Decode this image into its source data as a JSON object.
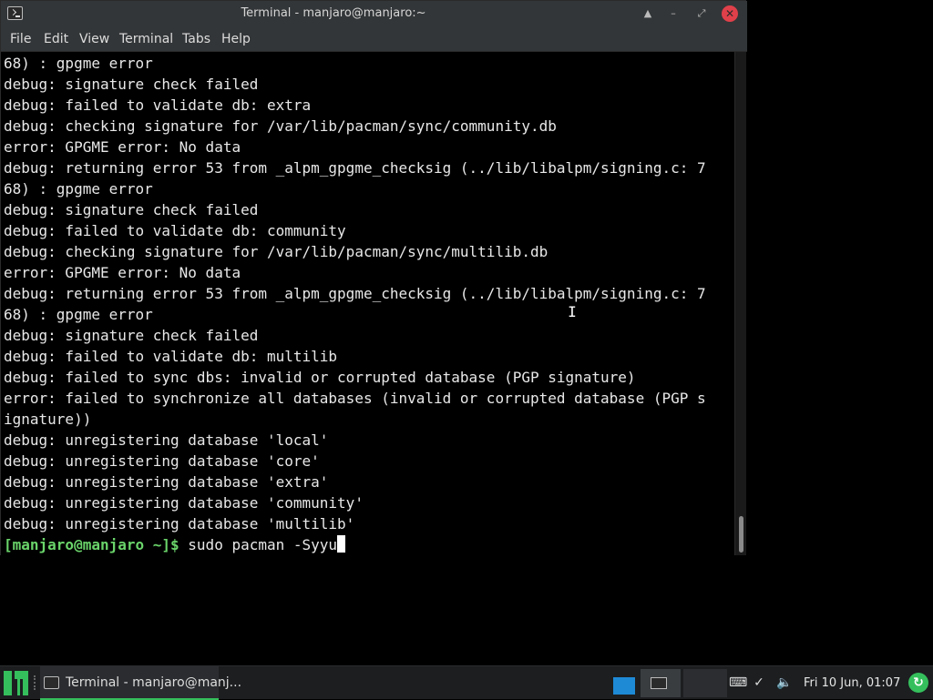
{
  "window": {
    "title": "Terminal - manjaro@manjaro:~"
  },
  "menu": {
    "items": [
      "File",
      "Edit",
      "View",
      "Terminal",
      "Tabs",
      "Help"
    ]
  },
  "terminal": {
    "lines": [
      "68) : gpgme error",
      "debug: signature check failed",
      "debug: failed to validate db: extra",
      "debug: checking signature for /var/lib/pacman/sync/community.db",
      "error: GPGME error: No data",
      "debug: returning error 53 from _alpm_gpgme_checksig (../lib/libalpm/signing.c: 7",
      "68) : gpgme error",
      "debug: signature check failed",
      "debug: failed to validate db: community",
      "debug: checking signature for /var/lib/pacman/sync/multilib.db",
      "error: GPGME error: No data",
      "debug: returning error 53 from _alpm_gpgme_checksig (../lib/libalpm/signing.c: 7",
      "68) : gpgme error",
      "debug: signature check failed",
      "debug: failed to validate db: multilib",
      "debug: failed to sync dbs: invalid or corrupted database (PGP signature)",
      "error: failed to synchronize all databases (invalid or corrupted database (PGP s",
      "ignature))",
      "debug: unregistering database 'local'",
      "debug: unregistering database 'core'",
      "debug: unregistering database 'extra'",
      "debug: unregistering database 'community'",
      "debug: unregistering database 'multilib'"
    ],
    "prompt": "[manjaro@manjaro ~]$",
    "command": " sudo pacman -Syyu"
  },
  "taskbar": {
    "task_label": "Terminal - manjaro@manj...",
    "clock": "Fri 10 Jun, 01:07",
    "colors": {
      "accent": "#35bf5c",
      "workspace": "#1e8ad6"
    }
  }
}
